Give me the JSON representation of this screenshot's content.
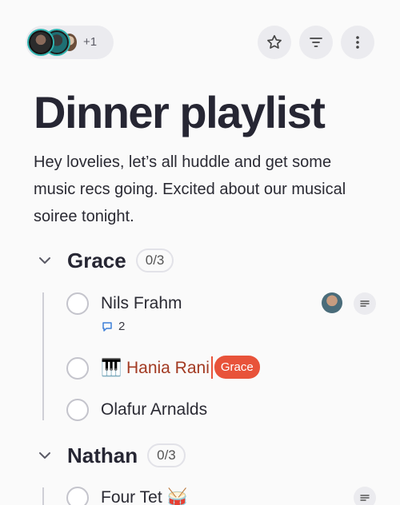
{
  "header": {
    "extra_collaborators": "+1",
    "collaborators": [
      {
        "name": "collaborator-1"
      },
      {
        "name": "collaborator-2"
      },
      {
        "name": "collaborator-3"
      }
    ],
    "icons": [
      "star-icon",
      "filter-icon",
      "more-vertical-icon"
    ]
  },
  "page": {
    "title": "Dinner playlist",
    "description": "Hey lovelies, let’s all huddle and get some music recs going. Excited about our musical soiree tonight."
  },
  "sections": [
    {
      "name": "Grace",
      "count": "0/3",
      "tasks": [
        {
          "label": "Nils Frahm",
          "comments": "2",
          "has_avatar": true,
          "has_notes": true
        },
        {
          "label": "🎹 Hania Rani",
          "cursor_user": "Grace",
          "editing": true
        },
        {
          "label": "Olafur Arnalds"
        }
      ]
    },
    {
      "name": "Nathan",
      "count": "0/3",
      "tasks": [
        {
          "label": "Four Tet 🥁",
          "has_notes": true
        }
      ]
    }
  ],
  "colors": {
    "accent": "#e8533a",
    "title": "#262633",
    "pill_bg": "#ebebef",
    "rail": "#cfcfd6"
  }
}
